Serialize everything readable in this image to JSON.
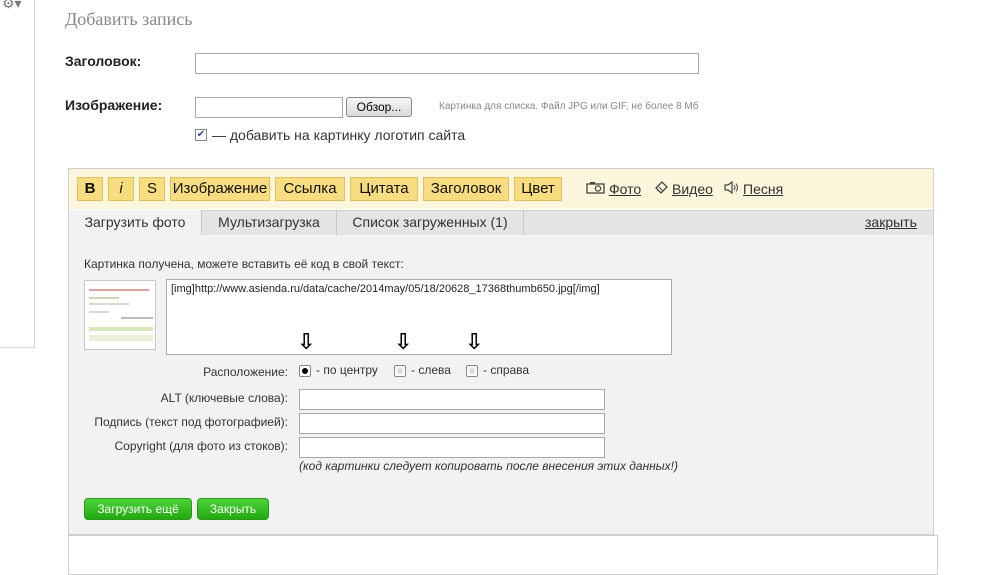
{
  "page": {
    "title": "Добавить запись",
    "heading_label": "Заголовок:",
    "heading_value": "",
    "image_label": "Изображение:",
    "browse_label": "Обзор...",
    "image_hint": "Картинка для списка. Файл JPG или GIF, не более 8 Мб",
    "logo_checkbox_label": "— добавить на картинку логотип сайта",
    "logo_checkbox_checked": true
  },
  "toolbar": {
    "buttons": [
      "B",
      "i",
      "S",
      "Изображение",
      "Ссылка",
      "Цитата",
      "Заголовок",
      "Цвет"
    ],
    "photo_link": "Фото",
    "video_link": "Видео",
    "song_link": "Песня"
  },
  "tabs": [
    {
      "label": "Загрузить фото",
      "active": true
    },
    {
      "label": "Мультизагрузка",
      "active": false
    },
    {
      "label": "Список загруженных (1)",
      "active": false
    }
  ],
  "close_label": "закрыть",
  "upload": {
    "info_text": "Картинка получена, можете вставить её код в свой текст:",
    "code": "[img]http://www.asienda.ru/data/cache/2014may/05/18/20628_17368thumb650.jpg[/img]",
    "position_label": "Расположение:",
    "positions": [
      {
        "label": "- по центру",
        "selected": true
      },
      {
        "label": "- слева",
        "selected": false
      },
      {
        "label": "- справа",
        "selected": false
      }
    ],
    "alt_label": "ALT (ключевые слова):",
    "caption_label": "Подпись (текст под фотографией):",
    "copyright_label": "Copyright (для фото из стоков):",
    "note": "(код картинки следует копировать после внесения этих данных!)",
    "upload_more_label": "Загрузить ещё",
    "close_button_label": "Закрыть"
  },
  "icons": {
    "gear": "gear-icon",
    "photo": "camera-icon",
    "video": "film-icon",
    "song": "speaker-icon",
    "arrow": "down-arrow-icon"
  },
  "colors": {
    "toolbar_button": "#f7dc80",
    "green_button": "#2bb51c"
  }
}
